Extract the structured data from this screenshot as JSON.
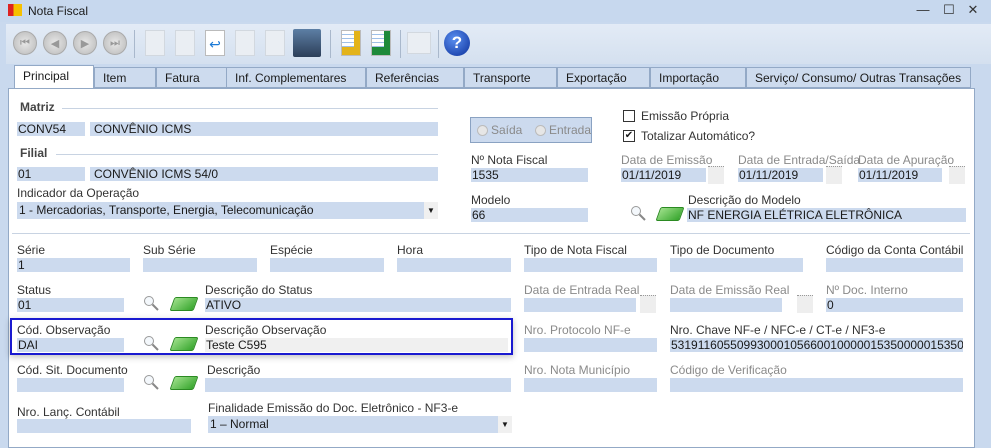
{
  "window": {
    "title": "Nota Fiscal",
    "minimize": "—",
    "maximize": "☐",
    "close": "✕"
  },
  "toolbar": {
    "icons": [
      "first-icon",
      "previous-icon",
      "next-icon",
      "last-icon",
      "new-icon",
      "edit-icon",
      "undo-icon",
      "delete-icon",
      "redo-icon",
      "save-icon",
      "report-coins-icon",
      "report-sum-icon",
      "lock-icon",
      "help-icon"
    ],
    "help_label": "?"
  },
  "tabs": [
    "Principal",
    "Item",
    "Fatura",
    "Inf. Complementares",
    "Referências",
    "Transporte",
    "Exportação",
    "Importação",
    "Serviço/ Consumo/ Outras Transações"
  ],
  "matriz": {
    "label": "Matriz",
    "code": "CONV54",
    "name": "CONVÊNIO ICMS"
  },
  "filial": {
    "label": "Filial",
    "code": "01",
    "name": "CONVÊNIO ICMS 54/0"
  },
  "indicador": {
    "label": "Indicador da Operação",
    "value": "1 - Mercadorias, Transporte, Energia, Telecomunicação"
  },
  "direction": {
    "saida": "Saída",
    "entrada": "Entrada"
  },
  "emissao_propria": {
    "label": "Emissão Própria",
    "checked": false
  },
  "totalizar": {
    "label": "Totalizar Automático?",
    "checked": true,
    "mark": "✔"
  },
  "nota": {
    "label": "Nº Nota Fiscal",
    "value": "1535"
  },
  "data_emissao": {
    "label": "Data de Emissão",
    "value": "01/11/2019"
  },
  "data_entrada": {
    "label": "Data de Entrada/Saída",
    "value": "01/11/2019"
  },
  "data_apuracao": {
    "label": "Data de Apuração",
    "value": "01/11/2019"
  },
  "modelo": {
    "label": "Modelo",
    "value": "66",
    "desc_label": "Descrição do Modelo",
    "desc_value": "NF ENERGIA ELÉTRICA ELETRÔNICA"
  },
  "row1": [
    {
      "label": "Série",
      "value": "1"
    },
    {
      "label": "Sub Série",
      "value": ""
    },
    {
      "label": "Espécie",
      "value": ""
    },
    {
      "label": "Hora",
      "value": ""
    },
    {
      "label": "Tipo de Nota Fiscal",
      "value": ""
    },
    {
      "label": "Tipo de Documento",
      "value": ""
    },
    {
      "label": "Código da Conta Contábil",
      "value": ""
    }
  ],
  "status": {
    "label": "Status",
    "value": "01",
    "desc_label": "Descrição do Status",
    "desc_value": "ATIVO"
  },
  "data_entrada_real": {
    "label": "Data de Entrada Real",
    "value": ""
  },
  "data_emissao_real": {
    "label": "Data de Emissão Real",
    "value": ""
  },
  "doc_interno": {
    "label": "Nº Doc. Interno",
    "value": "0"
  },
  "observacao": {
    "label": "Cód. Observação",
    "value": "DAI",
    "desc_label": "Descrição Observação",
    "desc_value": "Teste C595"
  },
  "protocolo": {
    "label": "Nro. Protocolo NF-e",
    "value": ""
  },
  "chave": {
    "label": "Nro. Chave NF-e / NFC-e / CT-e / NF3-e",
    "value": "53191160550993000105660010000015350000015350"
  },
  "sit_documento": {
    "label": "Cód. Sit. Documento",
    "value": "",
    "desc_label": "Descrição",
    "desc_value": ""
  },
  "nota_municipio": {
    "label": "Nro. Nota Município",
    "value": ""
  },
  "codigo_verificacao": {
    "label": "Código de Verificação",
    "value": ""
  },
  "lanc_contabil": {
    "label": "Nro. Lanç. Contábil",
    "value": ""
  },
  "finalidade": {
    "label": "Finalidade Emissão do Doc. Eletrônico - NF3-e",
    "value": "1 – Normal"
  }
}
